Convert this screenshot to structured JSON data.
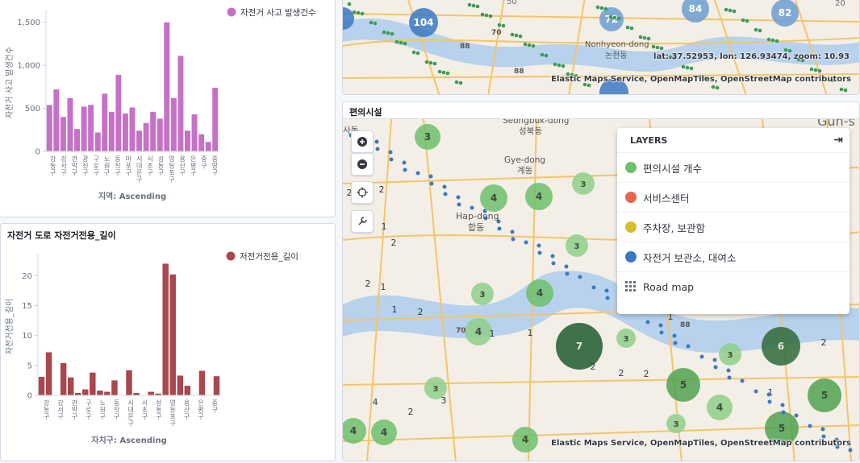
{
  "chart1": {
    "chart_data": {
      "type": "bar",
      "categories": [
        "강동구",
        "강북구",
        "강서구",
        "관악구",
        "광진구",
        "구로구",
        "금천구",
        "노원구",
        "도봉구",
        "동대문구",
        "동작구",
        "마포구",
        "서대문구",
        "서초구",
        "성동구",
        "성북구",
        "송파구",
        "양천구",
        "영등포구",
        "용산구",
        "은평구",
        "종로구",
        "중구",
        "중랑구"
      ],
      "series": [
        {
          "name": "자전거 사고 발생건수",
          "values": [
            540,
            720,
            400,
            620,
            260,
            520,
            540,
            220,
            670,
            460,
            890,
            440,
            510,
            240,
            330,
            460,
            380,
            1500,
            620,
            1110,
            240,
            430,
            200,
            110,
            740
          ]
        }
      ],
      "ylabel": "자전거 사고 발생건수",
      "xlabel": "지역: Ascending",
      "ylim": [
        0,
        1600
      ],
      "yticks": [
        "0",
        "500",
        "1,000",
        "1,500"
      ],
      "color": "#c571c7"
    },
    "x_tick_labels": [
      "강동구",
      "강서구",
      "관악구",
      "광진구",
      "구로구",
      "노원구",
      "동작구",
      "마포구",
      "서대문구",
      "서초구",
      "성동구",
      "영등포구",
      "용산구",
      "은평구",
      "중구",
      "중랑구"
    ]
  },
  "chart2": {
    "title": "자전거 도로 자전거전용_길이",
    "chart_data": {
      "type": "bar",
      "categories": [
        "강동구",
        "강북구",
        "강서구",
        "관악구",
        "광진구",
        "구로구",
        "금천구",
        "노원구",
        "도봉구",
        "동대문구",
        "동작구",
        "마포구",
        "서대문구",
        "서초구",
        "성동구",
        "성북구",
        "송파구",
        "양천구",
        "영등포구",
        "용산구",
        "은평구",
        "종로구",
        "중구",
        "중랑구"
      ],
      "series": [
        {
          "name": "저전거전용_길이",
          "values": [
            3.1,
            7.2,
            0,
            5.4,
            3.0,
            0.4,
            1.0,
            3.8,
            0.8,
            0.6,
            2.5,
            0,
            4.2,
            0.4,
            0,
            0.6,
            0.3,
            22,
            20.2,
            3.3,
            1.6,
            0,
            4.1,
            0,
            3.2
          ]
        }
      ],
      "ylabel": "자전거전용_길이",
      "xlabel": "자치구: Ascending",
      "ylim": [
        0,
        23
      ],
      "yticks": [
        "0",
        "5",
        "10",
        "15",
        "20"
      ],
      "color": "#a8474d"
    },
    "x_tick_labels": [
      "강동구",
      "강서구",
      "관악구",
      "구로구",
      "노원구",
      "동작구",
      "서대문구",
      "서초구",
      "성동구",
      "영등포구",
      "용산구",
      "은평구",
      "중구"
    ]
  },
  "map_top": {
    "coords": "lat: 37.52953, lon: 126.93474, zoom: 10.93",
    "attribution": "Elastic Maps Service, OpenMapTiles, OpenStreetMap contributors",
    "labels": [
      "Nonhyeon-dong",
      "논현동"
    ],
    "clusters": [
      "104",
      "72",
      "84",
      "82",
      "70",
      "88",
      "88",
      "50",
      "20"
    ]
  },
  "map_bottom": {
    "title": "편의시설",
    "attribution": "Elastic Maps Service, OpenMapTiles, OpenStreetMap contributors",
    "place_labels": [
      "Seongbuk-dong",
      "성북동",
      "Gye-dong",
      "계동",
      "Hap-dong",
      "합동",
      "Gun-s",
      "사동",
      "70",
      "88"
    ],
    "layers_title": "LAYERS",
    "layers": [
      {
        "label": "편의시설 개수",
        "color": "#6dbf6b"
      },
      {
        "label": "서비스센터",
        "color": "#e7664c"
      },
      {
        "label": "주차장, 보관함",
        "color": "#d6bf2b"
      },
      {
        "label": "자전거 보관소, 대여소",
        "color": "#3b78c3"
      },
      {
        "label": "Road map",
        "color": ""
      }
    ],
    "cluster_counts": [
      "3",
      "4",
      "4",
      "3",
      "3",
      "3",
      "4",
      "4",
      "7",
      "3",
      "6",
      "3",
      "2",
      "5",
      "4",
      "5",
      "5",
      "3",
      "4",
      "4",
      "4",
      "3",
      "2",
      "2",
      "1",
      "1",
      "1",
      "1",
      "2",
      "2",
      "2",
      "1",
      "1",
      "2",
      "2",
      "1",
      "2",
      "1",
      "3",
      "2",
      "4"
    ]
  }
}
